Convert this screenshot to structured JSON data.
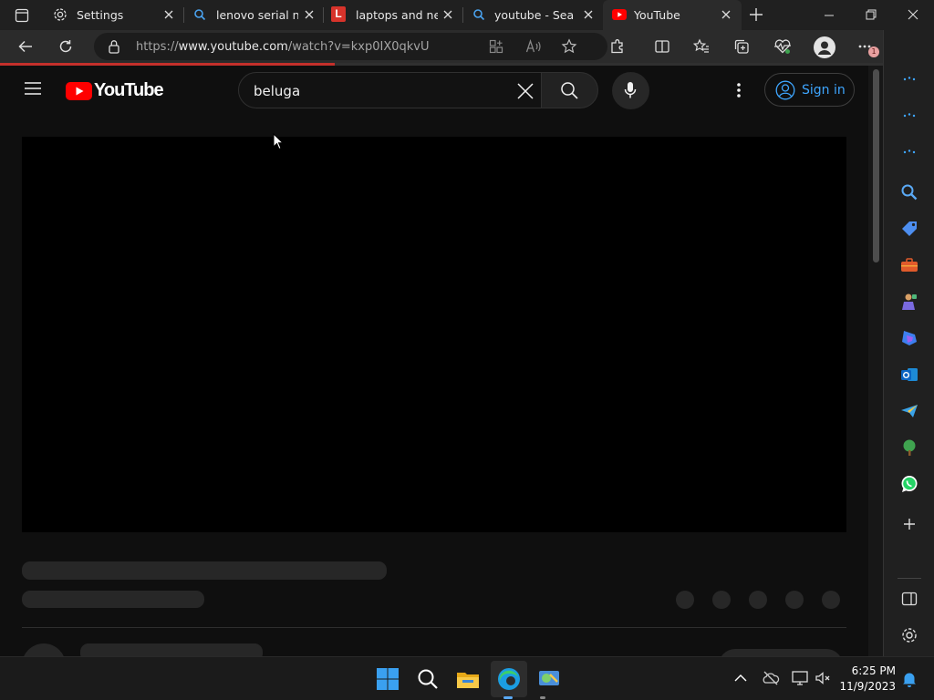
{
  "browser": {
    "tabs": [
      {
        "title": "Settings",
        "icon": "gear-icon"
      },
      {
        "title": "lenovo serial num",
        "icon": "search-icon"
      },
      {
        "title": "laptops and neth",
        "icon": "lenovo-l-icon"
      },
      {
        "title": "youtube - Search",
        "icon": "search-icon"
      },
      {
        "title": "YouTube",
        "icon": "youtube-icon",
        "active": true
      }
    ],
    "url_prefix": "https://",
    "url_host": "www.youtube.com",
    "url_path": "/watch?v=kxp0IX0qkvU",
    "notification_badge": "1"
  },
  "youtube": {
    "logo_text": "YouTube",
    "search_value": "beluga",
    "sign_in_label": "Sign in",
    "brand_color": "#ff0000",
    "link_color": "#3ea6ff"
  },
  "sidebar": {
    "icons": [
      "more-icon",
      "more-icon",
      "more-icon",
      "search-icon",
      "shopping-tag-icon",
      "tools-icon",
      "games-icon",
      "copilot-icon",
      "outlook-icon",
      "send-icon",
      "tree-icon",
      "whatsapp-icon",
      "add-icon",
      "panel-icon",
      "settings-icon"
    ]
  },
  "taskbar": {
    "time": "6:25 PM",
    "date": "11/9/2023",
    "apps": [
      "windows-start-icon",
      "search-icon",
      "file-explorer-icon",
      "edge-icon",
      "control-panel-icon"
    ]
  }
}
